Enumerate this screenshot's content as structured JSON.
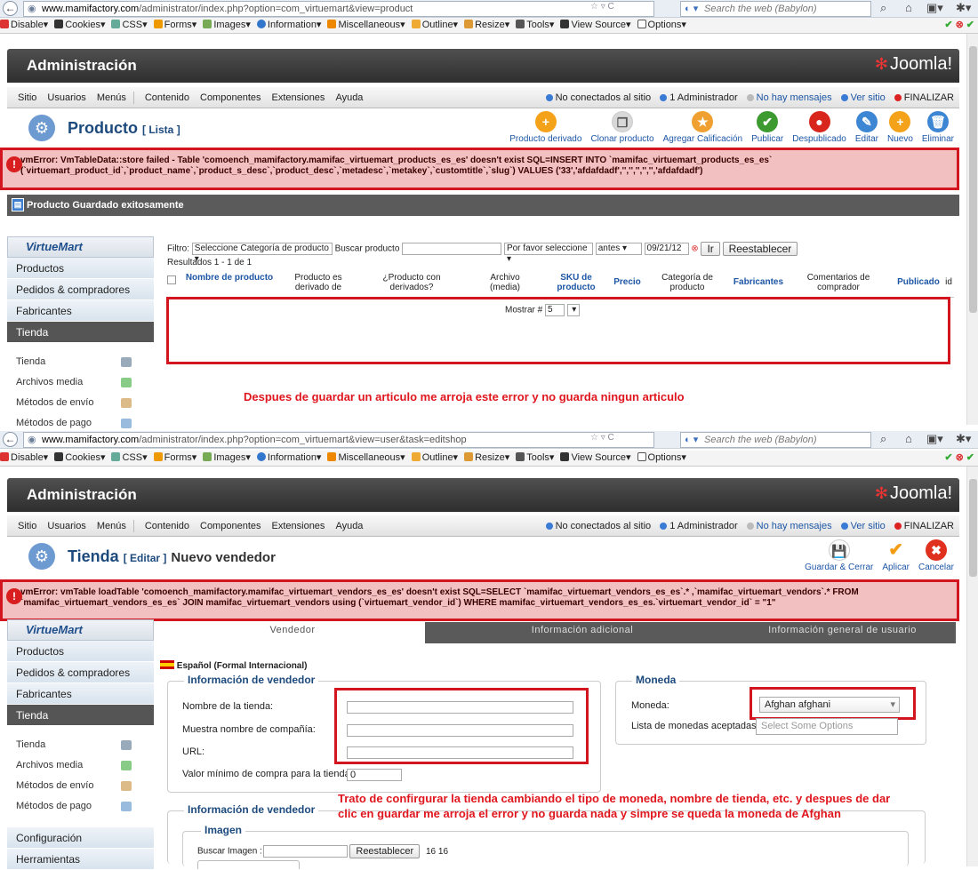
{
  "browser": {
    "top": {
      "url_domain": "www.mamifactory.com",
      "url_path": "/administrator/index.php?option=com_virtuemart&view=product",
      "search": "Search the web (Babylon)"
    },
    "bottom": {
      "url_domain": "www.mamifactory.com",
      "url_path": "/administrator/index.php?option=com_virtuemart&view=user&task=editshop",
      "search": "Search the web (Babylon)"
    },
    "proto": "www.",
    "webdev": [
      "Disable▾",
      "Cookies▾",
      "CSS▾",
      "Forms▾",
      "Images▾",
      "Information▾",
      "Miscellaneous▾",
      "Outline▾",
      "Resize▾",
      "Tools▾",
      "View Source▾",
      "Options▾"
    ]
  },
  "admin": {
    "title": "Administración",
    "logo": "Joomla!",
    "menu": [
      "Sitio",
      "Usuarios",
      "Menús",
      "Contenido",
      "Componentes",
      "Extensiones",
      "Ayuda"
    ],
    "status": [
      "No conectados al sitio",
      "1 Administrador",
      "No hay mensajes",
      "Ver sitio",
      "FINALIZAR"
    ]
  },
  "product": {
    "title": "Producto",
    "subtitle": "[ Lista ]",
    "tools": [
      {
        "label": "Producto derivado",
        "icon": "plus-circle-icon",
        "color": "#f5a21b",
        "glyph": "+"
      },
      {
        "label": "Clonar producto",
        "icon": "copy-icon",
        "color": "#d8d8d8",
        "glyph": "❐"
      },
      {
        "label": "Agregar Calificación",
        "icon": "star-icon",
        "color": "#f0a030",
        "glyph": "★"
      },
      {
        "label": "Publicar",
        "icon": "check-icon",
        "color": "#3d9a31",
        "glyph": "✔"
      },
      {
        "label": "Despublicado",
        "icon": "unpublish-icon",
        "color": "#d8261c",
        "glyph": "●"
      },
      {
        "label": "Editar",
        "icon": "edit-icon",
        "color": "#3c86d3",
        "glyph": "✎"
      },
      {
        "label": "Nuevo",
        "icon": "new-icon",
        "color": "#f5a21b",
        "glyph": "+"
      },
      {
        "label": "Eliminar",
        "icon": "trash-icon",
        "color": "#3c86d3",
        "glyph": "🗑"
      }
    ],
    "error": "vmError: VmTableData::store failed - Table 'comoench_mamifactory.mamifac_virtuemart_products_es_es' doesn't exist SQL=INSERT INTO `mamifac_virtuemart_products_es_es` (`virtuemart_product_id`,`product_name`,`product_s_desc`,`product_desc`,`metadesc`,`metakey`,`customtitle`,`slug`) VALUES ('33','afdafdadf','','','','','','afdafdadf')",
    "success": "Producto Guardado exitosamente",
    "filter": {
      "label": "Filtro:",
      "category": "Seleccione Categoría de producto",
      "search_label": "Buscar producto",
      "select": "Por favor seleccione",
      "when": "antes",
      "date": "09/21/12",
      "go": "Ir",
      "reset": "Reestablecer"
    },
    "results": "Resultados 1 - 1 de 1",
    "columns": [
      "Nombre de producto",
      "Producto es derivado de",
      "¿Producto con derivados?",
      "Archivo (media)",
      "SKU de producto",
      "Precio",
      "Categoría de producto",
      "Fabricantes",
      "Comentarios de comprador",
      "Publicado",
      "id"
    ],
    "show_label": "Mostrar #",
    "show_value": "5",
    "note": "Despues de guardar un articulo me arroja este error y no guarda ningun articulo"
  },
  "sidebar": {
    "brand": "VirtueMart",
    "items": [
      "Productos",
      "Pedidos & compradores",
      "Fabricantes",
      "Tienda"
    ],
    "sub": [
      "Tienda",
      "Archivos media",
      "Métodos de envío",
      "Métodos de pago"
    ],
    "extra": [
      "Configuración",
      "Herramientas"
    ]
  },
  "store": {
    "title": "Tienda",
    "subtitle": "[ Editar ]",
    "rest": "Nuevo vendedor",
    "tools": [
      {
        "label": "Guardar & Cerrar",
        "icon": "save-icon",
        "color": "#ffffff",
        "glyph": "💾"
      },
      {
        "label": "Aplicar",
        "icon": "apply-icon",
        "color": "#ffffff",
        "glyph": "✔"
      },
      {
        "label": "Cancelar",
        "icon": "cancel-icon",
        "color": "#e0301e",
        "glyph": "✖"
      }
    ],
    "error": "vmError: vmTable loadTable 'comoench_mamifactory.mamifac_virtuemart_vendors_es_es' doesn't exist SQL=SELECT `mamifac_virtuemart_vendors_es_es`.* ,`mamifac_virtuemart_vendors`.* FROM `mamifac_virtuemart_vendors_es_es` JOIN mamifac_virtuemart_vendors using (`virtuemart_vendor_id`) WHERE mamifac_virtuemart_vendors_es_es.`virtuemart_vendor_id` = \"1\"",
    "tabs": [
      "Vendedor",
      "Información adicional",
      "Información general de usuario"
    ],
    "lang": "Español (Formal Internacional)",
    "vendor_legend": "Información de vendedor",
    "fields": [
      "Nombre de la tienda:",
      "Muestra nombre de compañía:",
      "URL:",
      "Valor mínimo de compra para la tienda:"
    ],
    "min_value": "0",
    "currency_legend": "Moneda",
    "currency_label": "Moneda:",
    "currency_value": "Afghan afghani",
    "accepted_label": "Lista de monedas aceptadas:",
    "accepted_placeholder": "Select Some Options",
    "vendor_legend2": "Información de vendedor",
    "image_legend": "Imagen",
    "image_label": "Buscar Imagen :",
    "image_reset": "Reestablecer",
    "image_dims": "16 16",
    "note": "Trato de confirgurar la tienda cambiando el tipo de moneda, nombre de tienda, etc. y despues de dar clic en guardar me arroja el error y no guarda nada y simpre se queda la moneda de Afghan"
  }
}
